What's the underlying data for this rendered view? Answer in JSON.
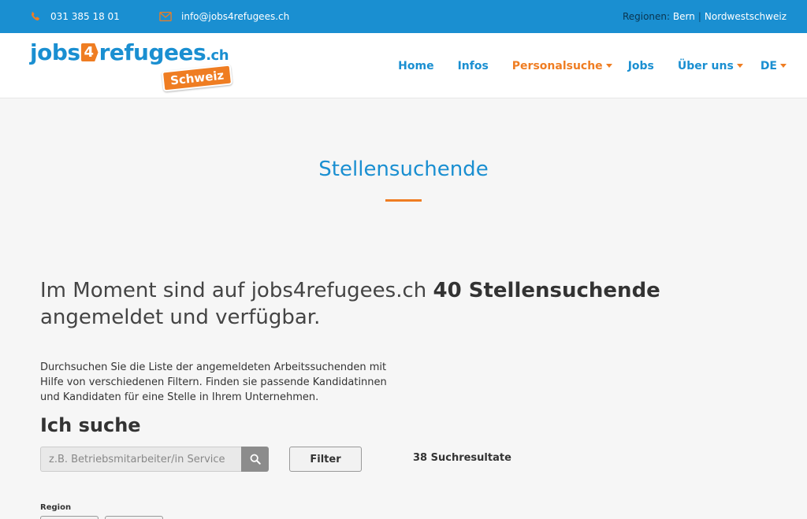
{
  "topbar": {
    "phone": "031 385 18 01",
    "email": "info@jobs4refugees.ch",
    "regions_label": "Regionen:",
    "regions": [
      "Bern",
      "Nordwestschweiz"
    ],
    "separator": "|"
  },
  "logo": {
    "part1": "jobs",
    "part2": "4",
    "part3": "refugees",
    "tld": ".ch",
    "badge": "Schweiz"
  },
  "nav": {
    "items": [
      {
        "label": "Home"
      },
      {
        "label": "Infos"
      },
      {
        "label": "Personalsuche"
      },
      {
        "label": "Jobs"
      },
      {
        "label": "Über uns"
      },
      {
        "label": "DE"
      }
    ]
  },
  "page": {
    "title": "Stellensuchende",
    "headline_pre": "Im Moment sind auf jobs4refugees.ch ",
    "headline_bold": "40 Stellensuchende",
    "headline_post": " angemeldet und verfügbar.",
    "description": "Durchsuchen Sie die Liste der angemeldeten Arbeitssuchenden mit Hilfe von verschiedenen Filtern. Finden sie passende Kandidatinnen und Kandidaten für eine Stelle in Ihrem Unternehmen.",
    "search_heading": "Ich suche",
    "search_placeholder": "z.B. Betriebsmitarbeiter/in Service",
    "filter_label": "Filter",
    "results": "38 Suchresultate",
    "region_label": "Region"
  },
  "colors": {
    "brand_blue": "#1a8fd1",
    "accent_orange": "#ef7d22"
  },
  "icons": {
    "phone": "phone-icon",
    "email": "mail-icon",
    "search": "search-icon",
    "caret": "caret-down-icon"
  }
}
